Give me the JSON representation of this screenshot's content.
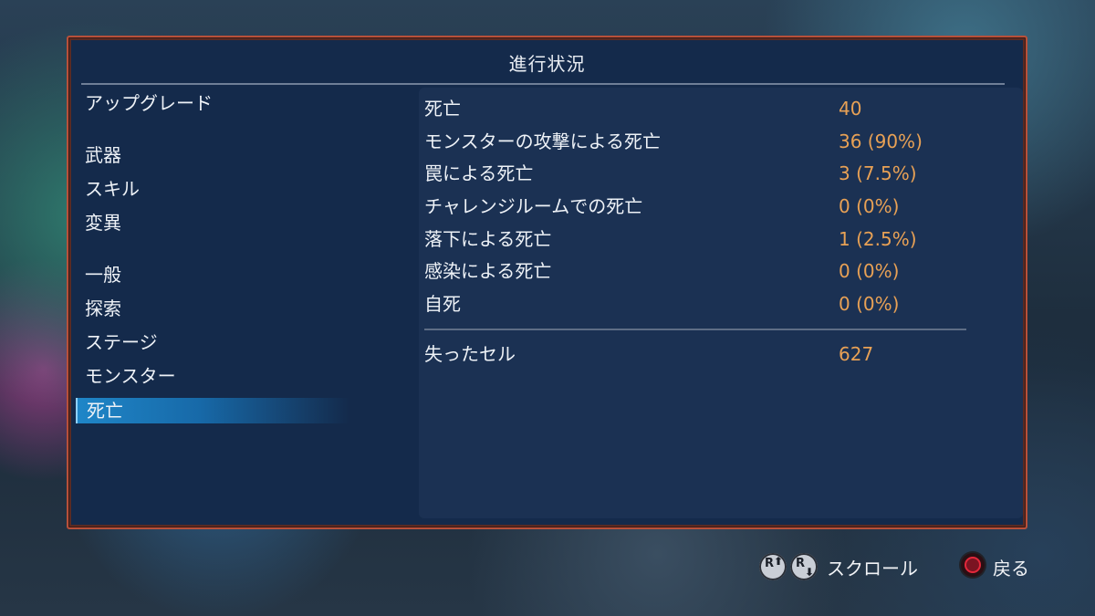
{
  "panel": {
    "title": "進行状況"
  },
  "menu": {
    "items": [
      {
        "label": "アップグレード"
      },
      {
        "label": "武器"
      },
      {
        "label": "スキル"
      },
      {
        "label": "変異"
      },
      {
        "label": "一般"
      },
      {
        "label": "探索"
      },
      {
        "label": "ステージ"
      },
      {
        "label": "モンスター"
      },
      {
        "label": "死亡",
        "selected": true
      }
    ]
  },
  "stats": {
    "rows": [
      {
        "label": "死亡",
        "value": "40"
      },
      {
        "label": "モンスターの攻撃による死亡",
        "value": "36 (90%)"
      },
      {
        "label": "罠による死亡",
        "value": "3 (7.5%)"
      },
      {
        "label": "チャレンジルームでの死亡",
        "value": "0 (0%)"
      },
      {
        "label": "落下による死亡",
        "value": "1 (2.5%)"
      },
      {
        "label": "感染による死亡",
        "value": "0 (0%)"
      },
      {
        "label": "自死",
        "value": "0 (0%)"
      }
    ],
    "total": {
      "label": "失ったセル",
      "value": "627"
    }
  },
  "footer": {
    "scroll_label": "スクロール",
    "back_label": "戻る",
    "r_glyph": "R",
    "up_arrow": "⬆",
    "down_arrow": "⬇"
  },
  "colors": {
    "accent_value": "#e8a155",
    "selected_bg": "#1f86c8",
    "border": "#b8503a"
  }
}
